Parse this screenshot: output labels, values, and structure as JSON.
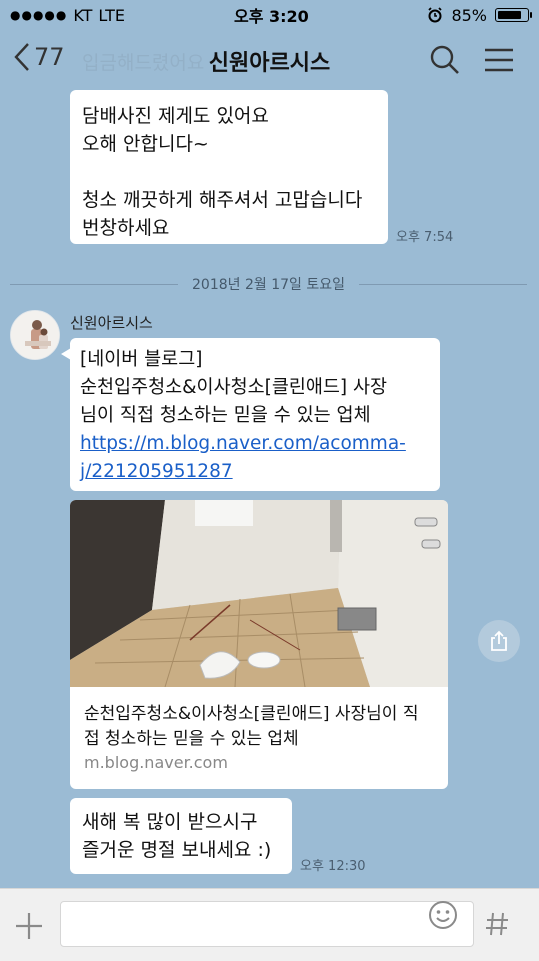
{
  "status": {
    "carrier": "KT",
    "network": "LTE",
    "time": "오후 3:20",
    "battery_text": "85%",
    "battery_level": 0.85
  },
  "header": {
    "back_count": "77",
    "title": "신원아르시스"
  },
  "faded_preview": "입금해드렸어요",
  "messages": {
    "m1": {
      "lines": [
        "담배사진 제게도 있어요",
        "오해 안합니다~",
        "",
        "청소 깨끗하게 해주셔서 고맙습니다",
        "번창하세요"
      ],
      "time": "오후 7:54"
    },
    "date_divider": "2018년 2월 17일 토요일",
    "sender_name": "신원아르시스",
    "m2": {
      "line1": "[네이버 블로그]",
      "line2": "순천입주청소&이사청소[클린애드] 사장",
      "line3": "님이 직접 청소하는 믿을 수 있는 업체",
      "link_line1": "https://m.blog.naver.com/acomma-",
      "link_line2": "j/221205951287"
    },
    "preview": {
      "title": "순천입주청소&이사청소[클린애드] 사장님이 직접 청소하는 믿을 수 있는 업체",
      "domain": "m.blog.naver.com"
    },
    "m3": {
      "line1": "새해 복 많이 받으시구",
      "line2": "즐거운 명절 보내세요 :)",
      "time": "오후 12:30"
    }
  },
  "colors": {
    "background": "#9bbbd4",
    "bubble": "#ffffff",
    "link": "#1a5fc8"
  },
  "icons": [
    "chevron-left-icon",
    "search-icon",
    "menu-icon",
    "share-icon",
    "plus-icon",
    "emoji-icon",
    "hash-icon"
  ]
}
